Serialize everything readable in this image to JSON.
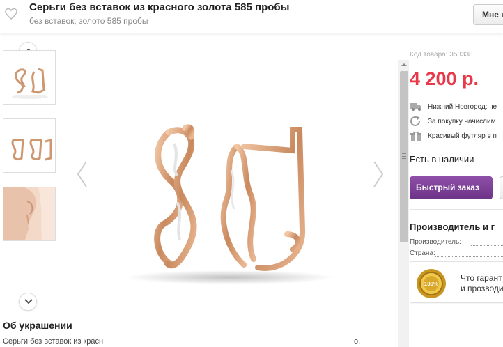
{
  "header": {
    "title": "Серьги без вставок из красного золота 585 пробы",
    "subtitle": "без вставок, золото 585 пробы",
    "like_button": "Мне н"
  },
  "gallery": {
    "thumbnails": [
      "earrings-front-view",
      "earrings-angle-view",
      "earrings-model-view"
    ]
  },
  "about": {
    "title": "Об украшении",
    "text": "Серьги без вставок из красн",
    "trailing": "о."
  },
  "product": {
    "sku": "Код товара: 353338",
    "price": "4 200 р.",
    "delivery": "Нижний Новгород: че",
    "bonus": "За покупку начислим",
    "gift": "Красивый футляр в п",
    "stock": "Есть в наличии",
    "quick_order": "Быстрый заказ"
  },
  "manufacturer": {
    "title": "Производитель и г",
    "manufacturer_label": "Производитель:",
    "country_label": "Страна:"
  },
  "guarantee": {
    "line1": "Что гарант",
    "line2": "и прозводи",
    "seal_text": "100%"
  },
  "colors": {
    "price": "#e8394a",
    "accent_button": "#7b3f96",
    "gold": "#d9a57e"
  }
}
